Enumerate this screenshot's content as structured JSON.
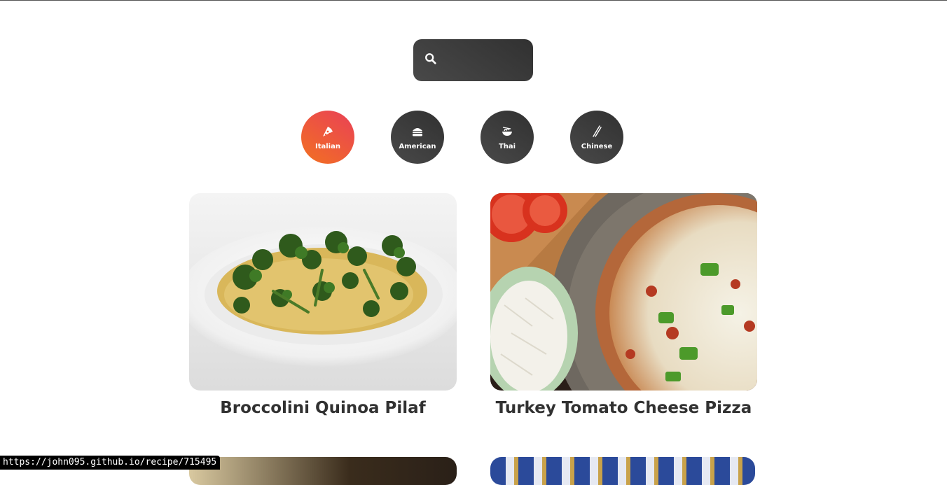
{
  "search": {
    "placeholder": "",
    "value": ""
  },
  "categories": [
    {
      "label": "Italian",
      "icon": "pizza-icon",
      "active": true
    },
    {
      "label": "American",
      "icon": "burger-icon",
      "active": false
    },
    {
      "label": "Thai",
      "icon": "noodle-bowl-icon",
      "active": false
    },
    {
      "label": "Chinese",
      "icon": "chopsticks-icon",
      "active": false
    }
  ],
  "recipes": [
    {
      "title": "Broccolini Quinoa Pilaf"
    },
    {
      "title": "Turkey Tomato Cheese Pizza"
    }
  ],
  "status_bar": {
    "url": "https://john095.github.io/recipe/715495"
  },
  "colors": {
    "accent_start": "#f27121",
    "accent_end": "#e94057",
    "dark": "#313131",
    "dark_light": "#494949"
  }
}
